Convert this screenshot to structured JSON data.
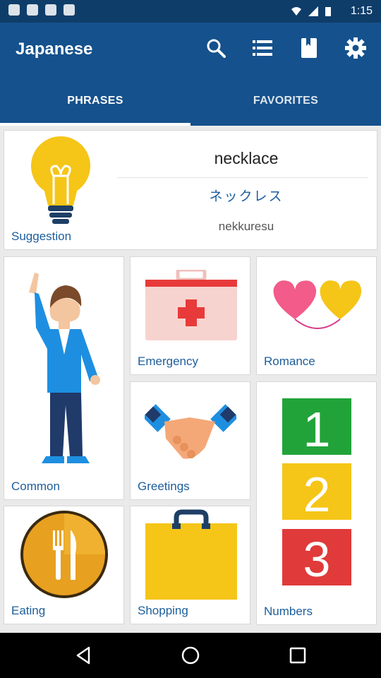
{
  "status_bar": {
    "time": "1:15"
  },
  "app_bar": {
    "title": "Japanese",
    "icons": [
      "search-icon",
      "list-icon",
      "book-icon",
      "gear-icon"
    ]
  },
  "tabs": [
    {
      "label": "PHRASES",
      "selected": true
    },
    {
      "label": "FAVORITES",
      "selected": false
    }
  ],
  "suggestion": {
    "label": "Suggestion",
    "word": "necklace",
    "kana": "ネックレス",
    "romaji": "nekkuresu"
  },
  "categories": [
    {
      "label": "Common"
    },
    {
      "label": "Emergency"
    },
    {
      "label": "Romance"
    },
    {
      "label": "Greetings"
    },
    {
      "label": "Numbers",
      "digits": [
        "1",
        "2",
        "3"
      ]
    },
    {
      "label": "Eating"
    },
    {
      "label": "Shopping"
    }
  ],
  "colors": {
    "app_bar": "#15518c",
    "status_bar": "#0f3d6a",
    "label_blue": "#1d5e9b"
  }
}
